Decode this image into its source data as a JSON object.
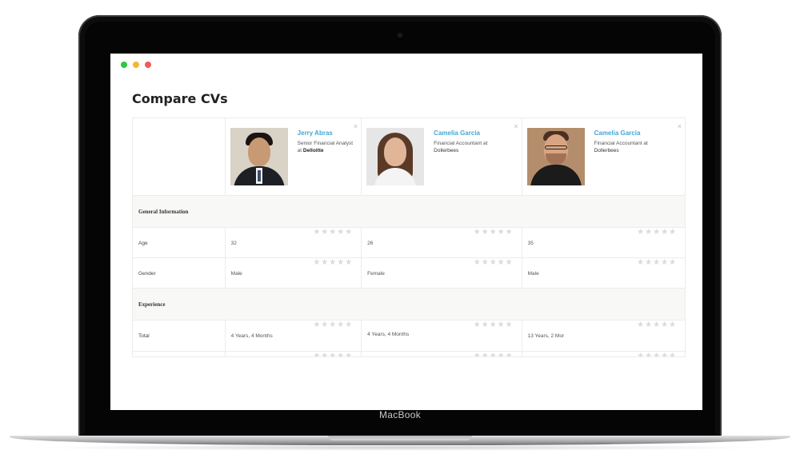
{
  "device": {
    "label": "MacBook"
  },
  "window": {
    "controls": [
      "close",
      "minimize",
      "maximize"
    ]
  },
  "page": {
    "title": "Compare CVs"
  },
  "candidates": [
    {
      "name": "Jerry Abras",
      "role": "Senior Financial Analyst",
      "at": "at",
      "company": "Delloitte"
    },
    {
      "name": "Camelia Garcia",
      "role": "Financial Accountant",
      "at": "at",
      "company": "Dollerbees"
    },
    {
      "name": "Camelia Garcia",
      "role": "Financial Accountant",
      "at": "at",
      "company": "Dollerbees"
    }
  ],
  "close_glyph": "×",
  "stars_glyph": "★★★★★",
  "sections": [
    {
      "title": "General Information",
      "rows": [
        {
          "label": "Age",
          "values": [
            "32",
            "26",
            "35"
          ]
        },
        {
          "label": "Gender",
          "values": [
            "Male",
            "Female",
            "Male"
          ]
        }
      ]
    },
    {
      "title": "Experience",
      "rows": [
        {
          "label": "Total",
          "values": [
            "4 Years, 4 Months",
            "4 Years, 4 Months",
            "13 Years, 2 Mor"
          ]
        }
      ]
    }
  ],
  "colors": {
    "accent": "#42a6d6",
    "dot_green": "#2bc840",
    "dot_yellow": "#f5b731",
    "dot_red": "#f45b56"
  }
}
